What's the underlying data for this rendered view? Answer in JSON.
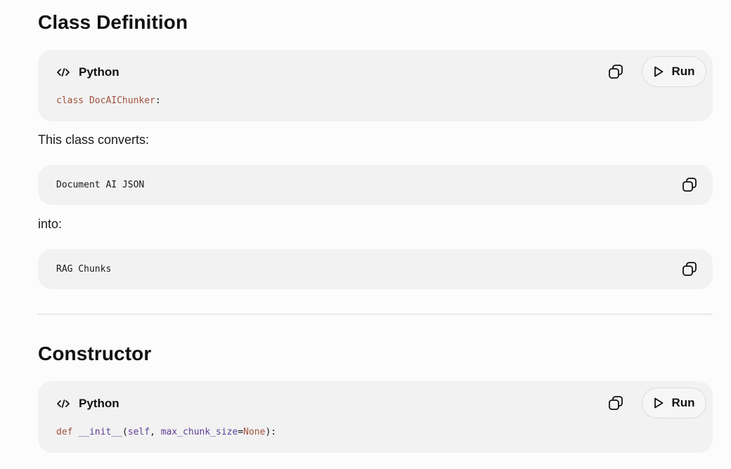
{
  "sections": [
    {
      "heading": "Class Definition",
      "code_block": {
        "language": "Python",
        "code": {
          "keyword": "class",
          "name": "DocAIChunker",
          "suffix": ":"
        },
        "run_label": "Run",
        "copy_icon": "copy-icon",
        "run_icon": "play-icon"
      },
      "text_1": "This class converts:",
      "plain_block_1": "Document AI JSON",
      "text_2": "into:",
      "plain_block_2": "RAG Chunks"
    },
    {
      "heading": "Constructor",
      "code_block": {
        "language": "Python",
        "code": {
          "keyword": "def",
          "name": "__init__",
          "open": "(",
          "self": "self",
          "comma": ", ",
          "param": "max_chunk_size",
          "eq": "=",
          "default": "None",
          "close": "):"
        },
        "run_label": "Run",
        "copy_icon": "copy-icon",
        "run_icon": "play-icon"
      }
    }
  ],
  "colors": {
    "page_background": "#fcfcfc",
    "code_background": "#f2f2f2",
    "keyword": "#a0523d",
    "parameter": "#5b3f98"
  }
}
